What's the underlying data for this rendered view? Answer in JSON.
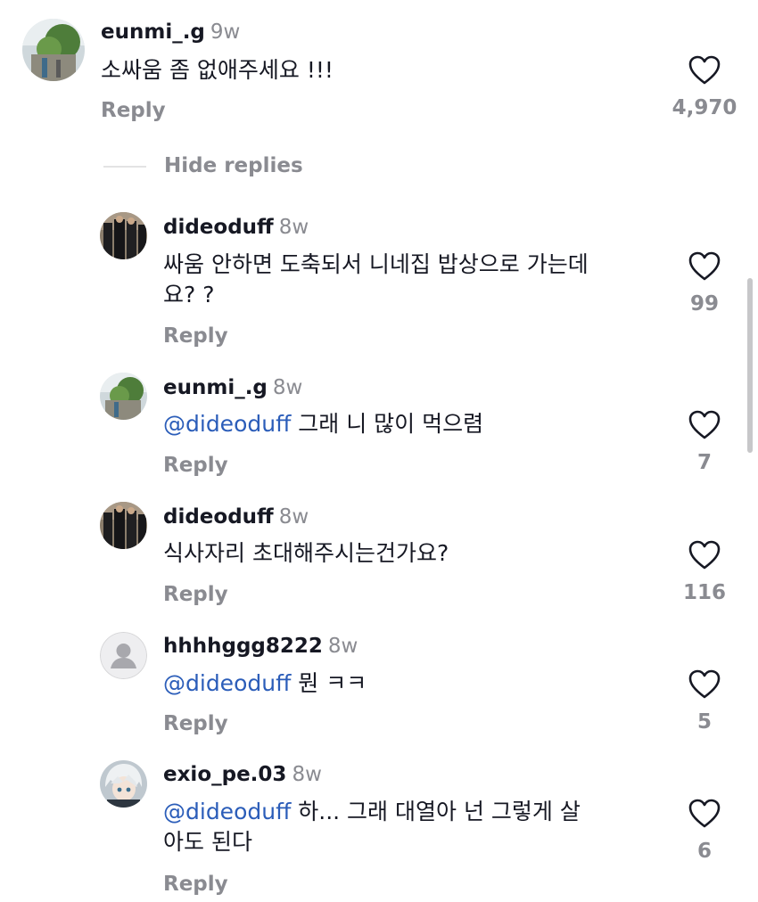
{
  "top_comment": {
    "username": "eunmi_.g",
    "age": "9w",
    "text": "소싸움 좀 없애주세요 !!!",
    "reply_label": "Reply",
    "like_count": "4,970"
  },
  "hide_replies_label": "Hide replies",
  "replies": [
    {
      "username": "dideoduff",
      "age": "8w",
      "mention": "",
      "text_line1": "싸움 안하면 도축되서 니네집 밥상으로 가는데",
      "text_line2": "요? ?",
      "reply_label": "Reply",
      "like_count": "99",
      "avatar": "suit"
    },
    {
      "username": "eunmi_.g",
      "age": "8w",
      "mention": "@dideoduff",
      "text_line1": " 그래 니 많이 먹으렴",
      "text_line2": "",
      "reply_label": "Reply",
      "like_count": "7",
      "avatar": "tree"
    },
    {
      "username": "dideoduff",
      "age": "8w",
      "mention": "",
      "text_line1": "식사자리 초대해주시는건가요?",
      "text_line2": "",
      "reply_label": "Reply",
      "like_count": "116",
      "avatar": "suit"
    },
    {
      "username": "hhhhggg8222",
      "age": "8w",
      "mention": "@dideoduff",
      "text_line1": " 뭔 ㅋㅋ",
      "text_line2": "",
      "reply_label": "Reply",
      "like_count": "5",
      "avatar": "default"
    },
    {
      "username": "exio_pe.03",
      "age": "8w",
      "mention": "@dideoduff",
      "text_line1": " 하... 그래 대열아 넌 그렇게 살",
      "text_line2": "아도 된다",
      "reply_label": "Reply",
      "like_count": "6",
      "avatar": "anime"
    }
  ],
  "colors": {
    "text": "#161823",
    "secondary": "#8a8b91",
    "mention": "#2b5db9",
    "divider": "#e3e3e4"
  },
  "icons": {
    "like": "heart-outline-icon"
  }
}
